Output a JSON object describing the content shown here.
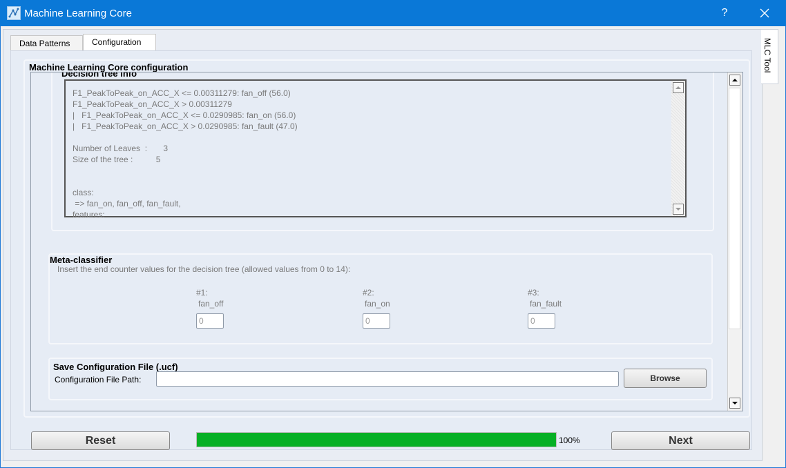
{
  "window": {
    "title": "Machine Learning Core",
    "help_label": "?"
  },
  "tabs": [
    {
      "label": "Data Patterns"
    },
    {
      "label": "Configuration"
    }
  ],
  "side_tab": {
    "label": "MLC Tool"
  },
  "main": {
    "section_title": "Machine Learning Core configuration",
    "decision_tree": {
      "title": "Decision tree info",
      "lines": [
        "F1_PeakToPeak_on_ACC_X <= 0.00311279: fan_off (56.0)",
        "F1_PeakToPeak_on_ACC_X > 0.00311279",
        "|   F1_PeakToPeak_on_ACC_X <= 0.0290985: fan_on (56.0)",
        "|   F1_PeakToPeak_on_ACC_X > 0.0290985: fan_fault (47.0)",
        "",
        "Number of Leaves  :       3",
        "Size of the tree :          5",
        "",
        "",
        "class:",
        " => fan_on, fan_off, fan_fault,",
        "features:"
      ]
    },
    "meta_classifier": {
      "title": "Meta-classifier",
      "instructions": "Insert the end counter values for the decision tree (allowed values from 0 to 14):",
      "counters": [
        {
          "index": "#1:",
          "class": "fan_off",
          "value": "0"
        },
        {
          "index": "#2:",
          "class": "fan_on",
          "value": "0"
        },
        {
          "index": "#3:",
          "class": "fan_fault",
          "value": "0"
        }
      ]
    },
    "save_config": {
      "title": "Save Configuration File (.ucf)",
      "path_label": "Configuration File Path:",
      "path_value": "",
      "browse_label": "Browse"
    }
  },
  "footer": {
    "reset_label": "Reset",
    "next_label": "Next",
    "progress_percent": 100,
    "progress_text": "100%",
    "progress_color": "#06b025"
  }
}
